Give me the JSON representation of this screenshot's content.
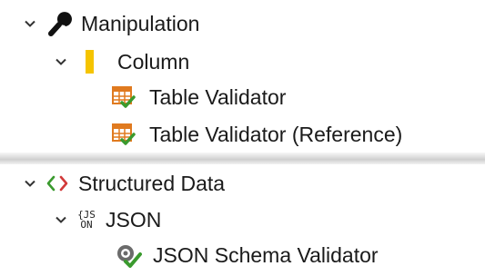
{
  "tree_top": {
    "manipulation": {
      "label": "Manipulation",
      "icon": "wrench-icon",
      "expanded": true
    },
    "column": {
      "label": "Column",
      "icon": "column-marker-icon",
      "expanded": true,
      "accent": "#f5c400"
    },
    "items": [
      {
        "label": "Table Validator",
        "icon": "table-validator-icon"
      },
      {
        "label": "Table Validator (Reference)",
        "icon": "table-validator-icon"
      }
    ]
  },
  "tree_bottom": {
    "structured_data": {
      "label": "Structured Data",
      "icon": "code-brackets-icon",
      "expanded": true
    },
    "json": {
      "label": "JSON",
      "icon": "json-icon",
      "icon_text_top": "{JS",
      "icon_text_bottom": "ON",
      "expanded": true
    },
    "items": [
      {
        "label": "JSON Schema Validator",
        "icon": "json-schema-validator-icon"
      }
    ]
  },
  "colors": {
    "table_orange": "#e07a1f",
    "check_green": "#3a9a2e",
    "bracket_red": "#d23a3a",
    "bracket_green": "#3a9a2e"
  }
}
